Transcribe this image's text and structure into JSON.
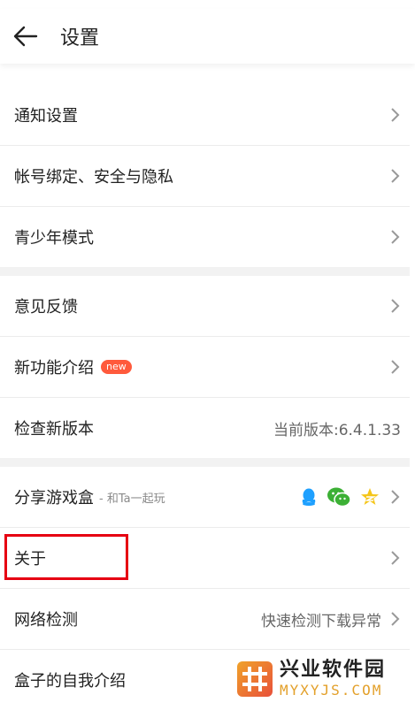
{
  "header": {
    "title": "设置"
  },
  "groups": [
    {
      "items": [
        {
          "label": "通知设置"
        },
        {
          "label": "帐号绑定、安全与隐私"
        },
        {
          "label": "青少年模式"
        }
      ]
    },
    {
      "items": [
        {
          "label": "意见反馈"
        },
        {
          "label": "新功能介绍",
          "badge": "new"
        },
        {
          "label": "检查新版本",
          "value": "当前版本:6.4.1.33"
        }
      ]
    },
    {
      "items": [
        {
          "label": "分享游戏盒",
          "sub": "- 和Ta一起玩"
        },
        {
          "label": "关于"
        },
        {
          "label": "网络检测",
          "value": "快速检测下载异常"
        },
        {
          "label": "盒子的自我介绍"
        }
      ]
    }
  ],
  "watermark": {
    "cn": "兴业软件园",
    "en": "MYXYJS.COM"
  },
  "colors": {
    "accent_red": "#e60012",
    "badge": "#ff5a3c",
    "qq": "#1ea0ff",
    "wechat": "#3cb035",
    "star": "#f5c518"
  }
}
